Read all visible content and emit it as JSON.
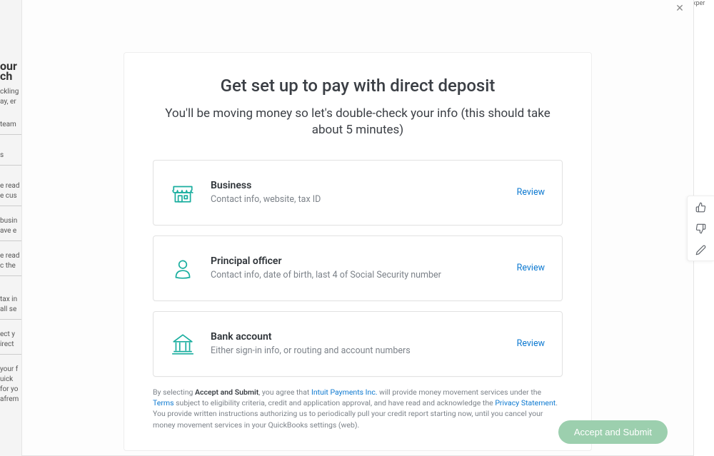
{
  "background": {
    "heading1": "our",
    "heading2": "ch",
    "frag1": "ckling",
    "frag2": "ay, er",
    "team": "team",
    "s": "s",
    "ready1": "e read",
    "cus": "e cus",
    "busin": "busin",
    "ave": "ave e",
    "ready2": "e read",
    "cthe": "c the ",
    "taxin": "tax in",
    "saltax": "all se",
    "county": "ect y",
    "direct": "irect ",
    "yourf": "your f",
    "quick": "uick",
    "fory": "for yo",
    "afr": "afrem",
    "topright": "xper"
  },
  "modal": {
    "title": "Get set up to pay with direct deposit",
    "subtitle": "You'll be moving money so let's double-check your info (this should take about 5 minutes)",
    "sections": [
      {
        "title": "Business",
        "desc": "Contact info, website, tax ID",
        "action": "Review"
      },
      {
        "title": "Principal officer",
        "desc": "Contact info, date of birth, last 4 of Social Security number",
        "action": "Review"
      },
      {
        "title": "Bank account",
        "desc": "Either sign-in info, or routing and account numbers",
        "action": "Review"
      }
    ],
    "legal": {
      "pre": "By selecting ",
      "bold1": "Accept and Submit",
      "mid1": ", you agree that ",
      "link1": "Intuit Payments Inc.",
      "mid2": " will provide money movement services under the ",
      "link2": "Terms",
      "mid3": " subject to eligibility criteria, credit and application approval, and have read and acknowledge the ",
      "link3": "Privacy Statement",
      "post": ". You provide written instructions authorizing us to periodically pull your credit report starting now, until you cancel your money movement services in your QuickBooks settings (web)."
    },
    "submit": "Accept and Submit"
  },
  "colors": {
    "icon_stroke": "#1aae9f"
  }
}
